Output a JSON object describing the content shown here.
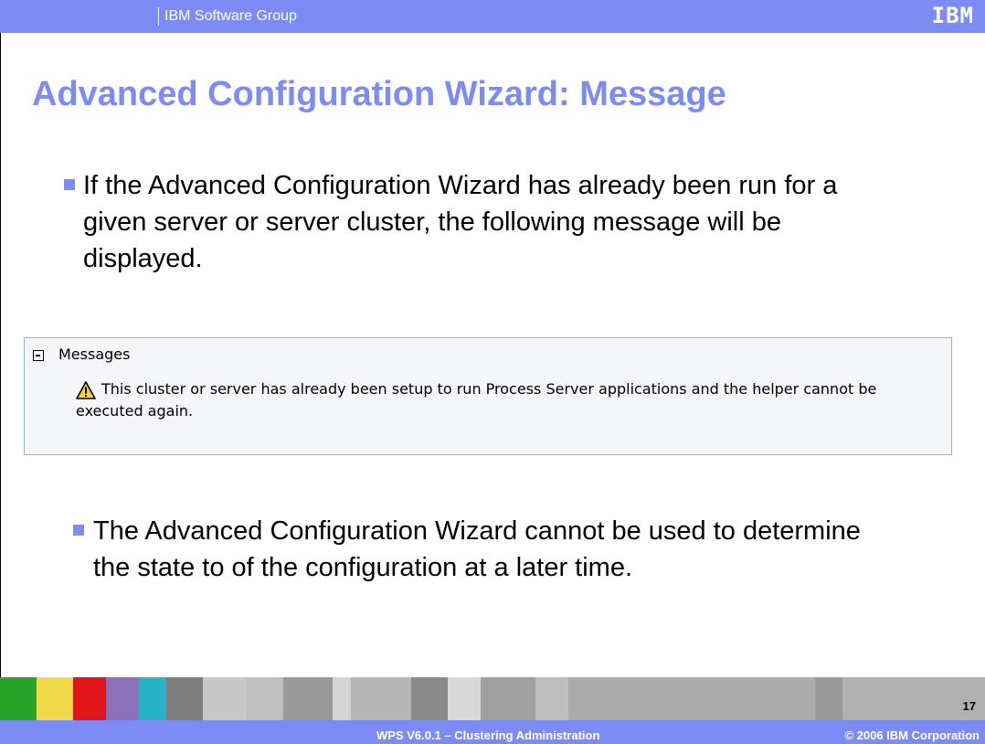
{
  "header": {
    "group": "IBM Software Group",
    "logo": "IBM"
  },
  "slide": {
    "title": "Advanced Configuration Wizard: Message",
    "bullets": [
      "If the Advanced Configuration Wizard has already been run for a given server or server cluster, the following message will be displayed.",
      "The Advanced Configuration Wizard cannot be used to determine the state to of the configuration at a later time."
    ]
  },
  "messages_panel": {
    "title": "Messages",
    "collapse_icon": "collapse-box-icon",
    "warning_icon": "warning-icon",
    "text": "This cluster or server has already been setup to run Process Server applications and the helper cannot be executed again."
  },
  "footer": {
    "course": "WPS V6.0.1 – Clustering Administration",
    "copyright": "© 2006 IBM Corporation",
    "page_number": "17"
  },
  "colors": {
    "accent": "#7d8cf4",
    "panel_border": "#9bb0c4",
    "panel_bg": "#f4f6f9",
    "warning": "#f5d23a"
  }
}
